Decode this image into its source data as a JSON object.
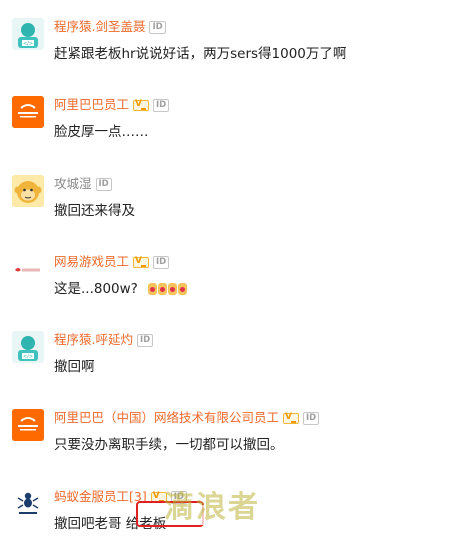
{
  "comments": [
    {
      "name": "程序猿.剑圣盖聂",
      "text": "赶紧跟老板hr说说好话，两万sers得1000万了啊",
      "name_style": "colored",
      "vbadge": false,
      "id_label": "ID",
      "avatar_icon": "programmer-avatar-icon"
    },
    {
      "name": "阿里巴巴员工",
      "text": "脸皮厚一点……",
      "name_style": "colored",
      "vbadge": true,
      "id_label": "ID",
      "avatar_icon": "alibaba-logo-icon"
    },
    {
      "name": "攻城湿",
      "text": "撤回还来得及",
      "name_style": "gray",
      "vbadge": false,
      "id_label": "ID",
      "avatar_icon": "monkey-avatar-icon"
    },
    {
      "name": "网易游戏员工",
      "text": "这是...800w?",
      "name_style": "colored",
      "vbadge": true,
      "id_label": "ID",
      "avatar_icon": "netease-logo-icon",
      "emoji_count": 4
    },
    {
      "name": "程序猿.呼延灼",
      "text": "撤回啊",
      "name_style": "colored",
      "vbadge": false,
      "id_label": "ID",
      "avatar_icon": "programmer-avatar-icon"
    },
    {
      "name": "阿里巴巴（中国）网络技术有限公司员工",
      "text": "只要没办离职手续，一切都可以撤回。",
      "name_style": "colored",
      "vbadge": true,
      "id_label": "ID",
      "avatar_icon": "alibaba-logo-icon"
    },
    {
      "name": "蚂蚁金服员工[3]",
      "text": "撤回吧老哥 给老板",
      "name_style": "colored",
      "vbadge": true,
      "id_label": "ID",
      "avatar_icon": "ant-financial-logo-icon"
    }
  ],
  "colors": {
    "name_accent": "#ee6a2c",
    "name_gray": "#888888",
    "alibaba_orange": "#ff6a00",
    "highlight_red": "#e02020"
  },
  "watermark": "滴浪者"
}
